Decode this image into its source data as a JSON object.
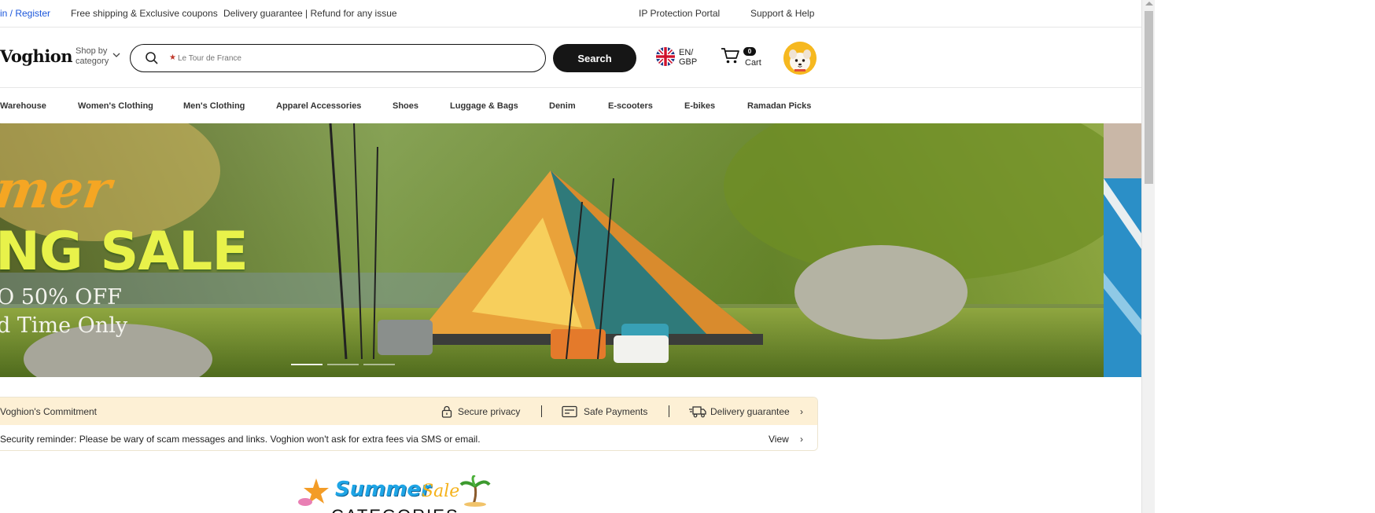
{
  "topbar": {
    "signin": "in / Register",
    "shipping": "Free shipping & Exclusive coupons",
    "delivery": "Delivery guarantee | Refund for any issue",
    "ip_portal": "IP Protection Portal",
    "support": "Support & Help"
  },
  "header": {
    "logo": "Voghion",
    "shop_by_line1": "Shop by",
    "shop_by_line2": "category",
    "search": {
      "placeholder": "Le Tour de France"
    },
    "search_button": "Search",
    "lang_line1": "EN/",
    "lang_line2": "GBP",
    "cart_count": "0",
    "cart_label": "Cart"
  },
  "categories": [
    "Warehouse",
    "Women's Clothing",
    "Men's Clothing",
    "Apparel Accessories",
    "Shoes",
    "Luggage & Bags",
    "Denim",
    "E-scooters",
    "E-bikes",
    "Ramadan Picks"
  ],
  "banner": {
    "script": "mer",
    "headline": "NG SALE",
    "offer": "O 50% OFF",
    "limited": "d Time Only"
  },
  "commitment": {
    "title": "Voghion's Commitment",
    "privacy": "Secure privacy",
    "payments": "Safe Payments",
    "delivery": "Delivery guarantee",
    "reminder": "Security reminder: Please be wary of scam messages and links. Voghion won't ask for extra fees via SMS or email.",
    "view": "View"
  },
  "summer": {
    "title": "Summer",
    "sale": "Sale",
    "heading": "CATEGORIES"
  },
  "colors": {
    "accent_dark": "#161616",
    "link_blue": "#1a56db",
    "commitment_bg": "#fdf0d5"
  }
}
